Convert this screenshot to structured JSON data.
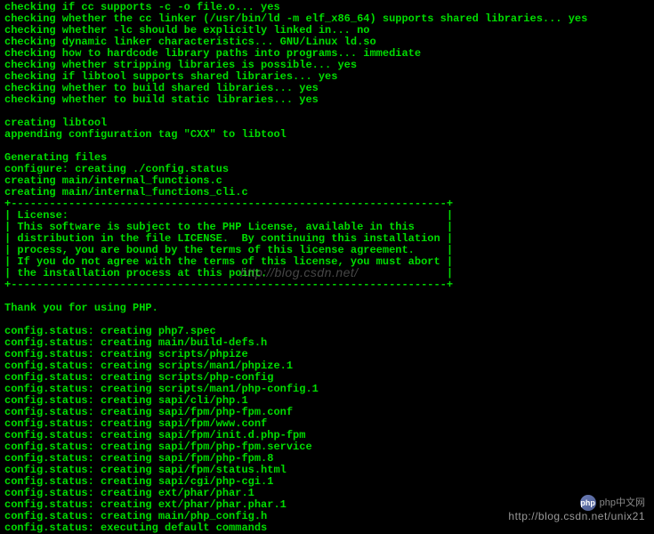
{
  "terminal": {
    "lines": [
      "checking if cc supports -c -o file.o... yes",
      "checking whether the cc linker (/usr/bin/ld -m elf_x86_64) supports shared libraries... yes",
      "checking whether -lc should be explicitly linked in... no",
      "checking dynamic linker characteristics... GNU/Linux ld.so",
      "checking how to hardcode library paths into programs... immediate",
      "checking whether stripping libraries is possible... yes",
      "checking if libtool supports shared libraries... yes",
      "checking whether to build shared libraries... yes",
      "checking whether to build static libraries... yes",
      "",
      "creating libtool",
      "appending configuration tag \"CXX\" to libtool",
      "",
      "Generating files",
      "configure: creating ./config.status",
      "creating main/internal_functions.c",
      "creating main/internal_functions_cli.c",
      "+--------------------------------------------------------------------+",
      "| License:                                                           |",
      "| This software is subject to the PHP License, available in this     |",
      "| distribution in the file LICENSE.  By continuing this installation |",
      "| process, you are bound by the terms of this license agreement.     |",
      "| If you do not agree with the terms of this license, you must abort |",
      "| the installation process at this point.                            |",
      "+--------------------------------------------------------------------+",
      "",
      "Thank you for using PHP.",
      "",
      "config.status: creating php7.spec",
      "config.status: creating main/build-defs.h",
      "config.status: creating scripts/phpize",
      "config.status: creating scripts/man1/phpize.1",
      "config.status: creating scripts/php-config",
      "config.status: creating scripts/man1/php-config.1",
      "config.status: creating sapi/cli/php.1",
      "config.status: creating sapi/fpm/php-fpm.conf",
      "config.status: creating sapi/fpm/www.conf",
      "config.status: creating sapi/fpm/init.d.php-fpm",
      "config.status: creating sapi/fpm/php-fpm.service",
      "config.status: creating sapi/fpm/php-fpm.8",
      "config.status: creating sapi/fpm/status.html",
      "config.status: creating sapi/cgi/php-cgi.1",
      "config.status: creating ext/phar/phar.1",
      "config.status: creating ext/phar/phar.phar.1",
      "config.status: creating main/php_config.h",
      "config.status: executing default commands"
    ]
  },
  "watermarks": {
    "center": "http://blog.csdn.net/",
    "bottom": "http://blog.csdn.net/unix21",
    "logo_text": "php中文网"
  }
}
